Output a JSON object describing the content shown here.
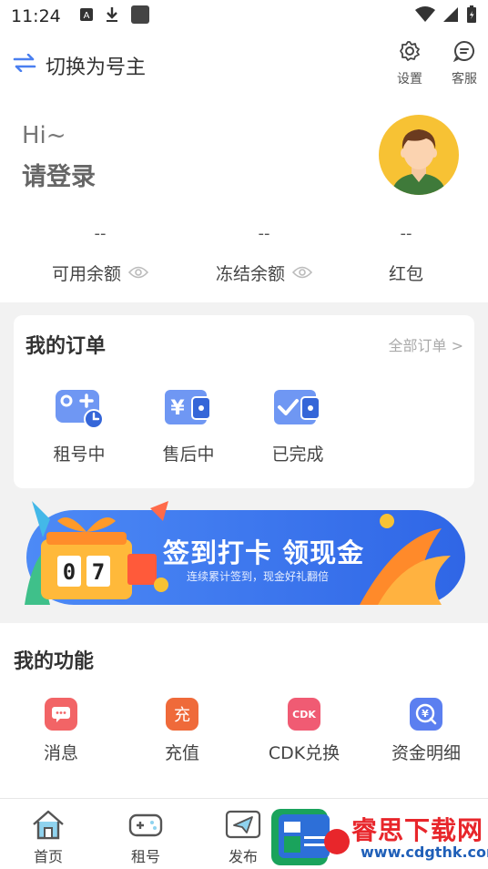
{
  "status_bar": {
    "time": "11:24"
  },
  "top_bar": {
    "switch_label": "切换为号主",
    "settings_label": "设置",
    "service_label": "客服"
  },
  "profile": {
    "greeting": "Hi~",
    "login_prompt": "请登录",
    "stats": [
      {
        "value": "--",
        "label": "可用余额"
      },
      {
        "value": "--",
        "label": "冻结余额"
      },
      {
        "value": "--",
        "label": "红包"
      }
    ]
  },
  "orders": {
    "title": "我的订单",
    "all_link": "全部订单 >",
    "items": [
      {
        "label": "租号中",
        "icon": "gamepad-clock-icon"
      },
      {
        "label": "售后中",
        "icon": "yen-wallet-icon"
      },
      {
        "label": "已完成",
        "icon": "check-wallet-icon"
      }
    ]
  },
  "banner": {
    "headline": "签到打卡 领现金",
    "subtext": "连续累计签到，现金好礼翻倍",
    "counter": [
      "0",
      "7"
    ]
  },
  "functions": {
    "title": "我的功能",
    "items": [
      {
        "label": "消息",
        "icon": "message-icon",
        "icon_text": ""
      },
      {
        "label": "充值",
        "icon": "recharge-icon",
        "icon_text": "充"
      },
      {
        "label": "CDK兑换",
        "icon": "cdk-icon",
        "icon_text": "CDK"
      },
      {
        "label": "资金明细",
        "icon": "fund-detail-icon",
        "icon_text": ""
      }
    ]
  },
  "tab_bar": {
    "items": [
      {
        "label": "首页",
        "icon": "home-icon"
      },
      {
        "label": "租号",
        "icon": "gamepad-icon"
      },
      {
        "label": "发布",
        "icon": "send-icon"
      }
    ]
  },
  "watermark": {
    "text": "睿思下载网",
    "url": "www.cdgthk.com"
  },
  "colors": {
    "accent_blue": "#4a7ff0",
    "avatar_yellow": "#f7c234",
    "banner_blue": "#3d7cf2",
    "watermark_red": "#e8262b"
  }
}
